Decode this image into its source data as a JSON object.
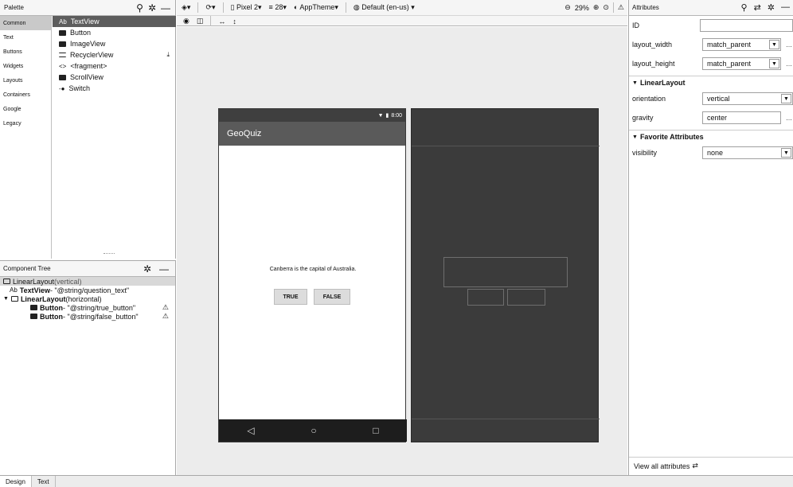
{
  "palette": {
    "title": "Palette",
    "categories": [
      "Common",
      "Text",
      "Buttons",
      "Widgets",
      "Layouts",
      "Containers",
      "Google",
      "Legacy"
    ],
    "items": [
      {
        "icon": "Ab",
        "label": "TextView"
      },
      {
        "label": "Button"
      },
      {
        "label": "ImageView"
      },
      {
        "label": "RecyclerView"
      },
      {
        "icon": "<>",
        "label": "<fragment>"
      },
      {
        "label": "ScrollView"
      },
      {
        "label": "Switch"
      }
    ]
  },
  "tree": {
    "title": "Component Tree",
    "rows": [
      {
        "text": "LinearLayout",
        "sub": "(vertical)"
      },
      {
        "prefix": "Ab",
        "text": "TextView",
        "sub": "- \"@string/question_text\""
      },
      {
        "text": "LinearLayout",
        "sub": "(horizontal)"
      },
      {
        "text": "Button",
        "sub": "- \"@string/true_button\""
      },
      {
        "text": "Button",
        "sub": "- \"@string/false_button\""
      }
    ]
  },
  "toolbar": {
    "device": "Pixel 2",
    "api": "28",
    "theme": "AppTheme",
    "locale": "Default (en-us)",
    "zoom": "29%"
  },
  "preview": {
    "time": "8:00",
    "app_title": "GeoQuiz",
    "question": "Canberra is the capital of Australia.",
    "true_label": "TRUE",
    "false_label": "FALSE"
  },
  "attributes": {
    "title": "Attributes",
    "id_label": "ID",
    "id_value": "",
    "layout_width_label": "layout_width",
    "layout_width_value": "match_parent",
    "layout_height_label": "layout_height",
    "layout_height_value": "match_parent",
    "section1": "LinearLayout",
    "orientation_label": "orientation",
    "orientation_value": "vertical",
    "gravity_label": "gravity",
    "gravity_value": "center",
    "section2": "Favorite Attributes",
    "visibility_label": "visibility",
    "visibility_value": "none",
    "view_all": "View all attributes"
  },
  "bottom_tabs": [
    "Design",
    "Text"
  ]
}
